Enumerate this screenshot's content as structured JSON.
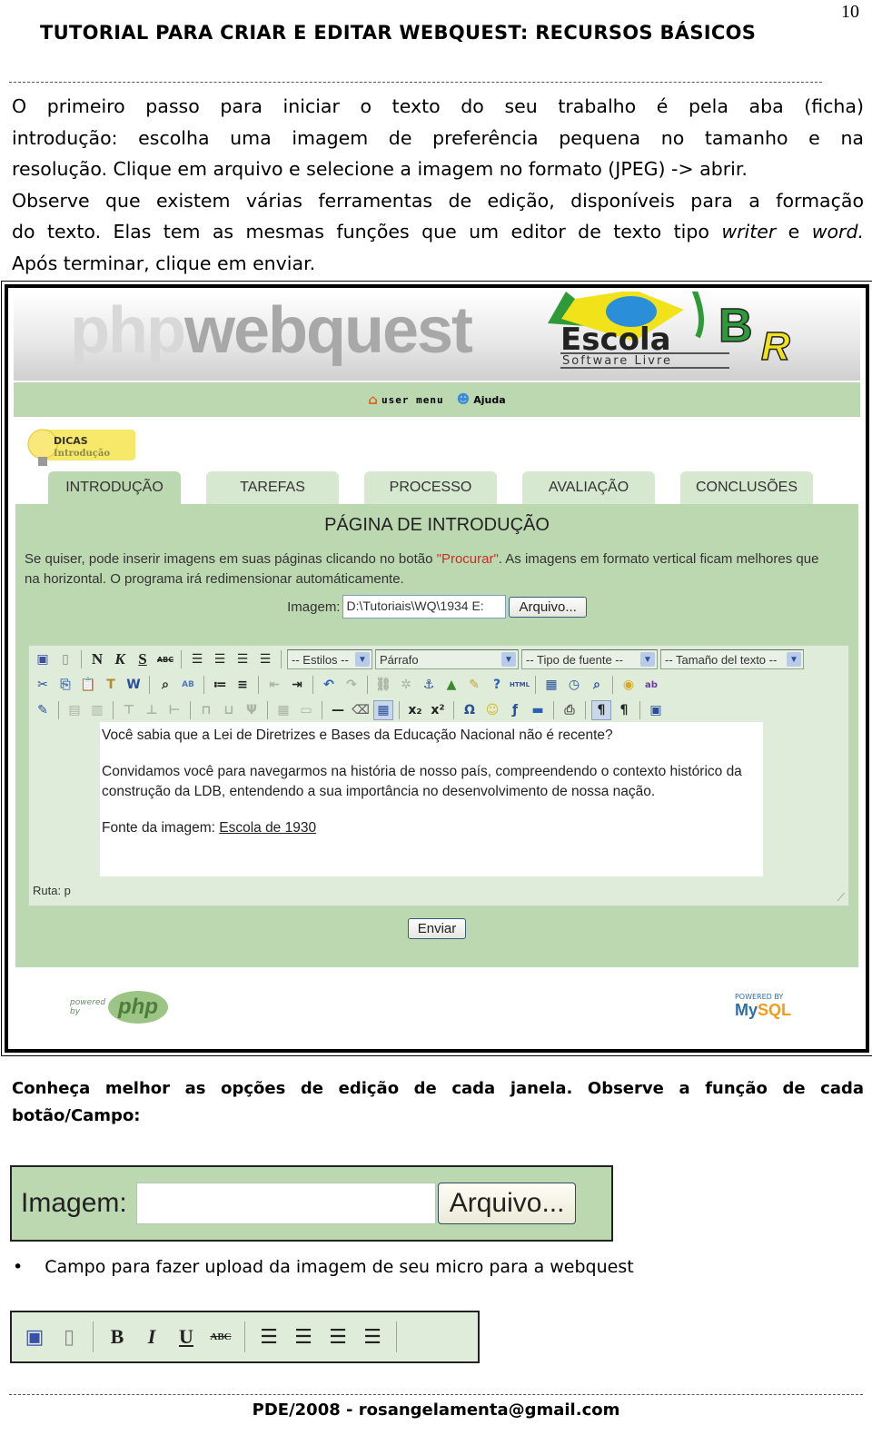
{
  "page_number": "10",
  "doc_title": "TUTORIAL PARA CRIAR E EDITAR WEBQUEST: RECURSOS BÁSICOS",
  "intro": {
    "line1": "O primeiro passo para iniciar o texto do seu trabalho é pela aba (ficha)",
    "line2": "introdução: escolha uma imagem de preferência pequena no tamanho e na",
    "line3": "resolução. Clique em arquivo e selecione a imagem no formato (JPEG) -> abrir.",
    "line4": "Observe que existem várias ferramentas de edição, disponíveis para a formação",
    "line5_a": "do texto. Elas tem as mesmas funções que um editor de texto tipo ",
    "line5_writer": "writer",
    "line5_e": " e ",
    "line5_word": "word.",
    "line6": "Após terminar, clique em enviar."
  },
  "screenshot": {
    "brand_php": "php",
    "brand_webquest": "webquest",
    "logo_escola": "Escola",
    "logo_br": "BR",
    "logo_sub": "Software Livre",
    "user_menu": "user menu",
    "help": "Ajuda",
    "dicas_title": "DICAS",
    "dicas_sub": "Introdução",
    "tabs": [
      {
        "label": "INTRODUÇÃO",
        "active": true
      },
      {
        "label": "TAREFAS",
        "active": false
      },
      {
        "label": "PROCESSO",
        "active": false
      },
      {
        "label": "AVALIAÇÃO",
        "active": false
      },
      {
        "label": "CONCLUSÕES",
        "active": false
      }
    ],
    "page_title": "PÁGINA DE INTRODUÇÃO",
    "help_text_a": "Se quiser, pode inserir imagens em suas páginas clicando no botão ",
    "help_text_red": "\"Procurar\"",
    "help_text_b": ". As imagens em formato vertical ficam melhores que na horizontal. O programa irá redimensionar automáticamente.",
    "image_label": "Imagem:",
    "image_value": "D:\\Tutoriais\\WQ\\1934 E:",
    "file_button": "Arquivo...",
    "toolbar": {
      "bold": "N",
      "italic": "K",
      "underline": "S",
      "strike": "ABC",
      "styles_select": "-- Estilos --",
      "format_select": "Párrafo",
      "font_select": "-- Tipo de fuente --",
      "size_select": "-- Tamaño del texto --",
      "html_label": "HTML"
    },
    "content": {
      "p1": "Você sabia que a Lei de Diretrizes e Bases da Educação Nacional não é recente?",
      "p2": "Convidamos você para navegarmos na história de nosso país, compreendendo o contexto histórico da construção da LDB, entendendo a sua importância no desenvolvimento de nossa nação.",
      "p3_label": "Fonte da imagem: ",
      "p3_link": "Escola de 1930"
    },
    "path": "Ruta: p",
    "submit": "Enviar",
    "powered_by": "powered by",
    "php_logo": "php",
    "mysql_powered": "POWERED BY",
    "mysql_my": "My",
    "mysql_sql": "SQL"
  },
  "know_more": {
    "line1": "Conheça melhor as opções de edição de cada janela. Observe a função de cada",
    "line2": "botão/Campo:"
  },
  "image_field_demo": {
    "label": "Imagem:",
    "value": "",
    "button": "Arquivo..."
  },
  "bullet_text": "Campo para fazer upload da imagem de seu micro para a webquest",
  "toolbar_demo": {
    "bold": "B",
    "italic": "I",
    "underline": "U",
    "strike": "ABC"
  },
  "footer": "PDE/2008 - rosangelamenta@gmail.com"
}
